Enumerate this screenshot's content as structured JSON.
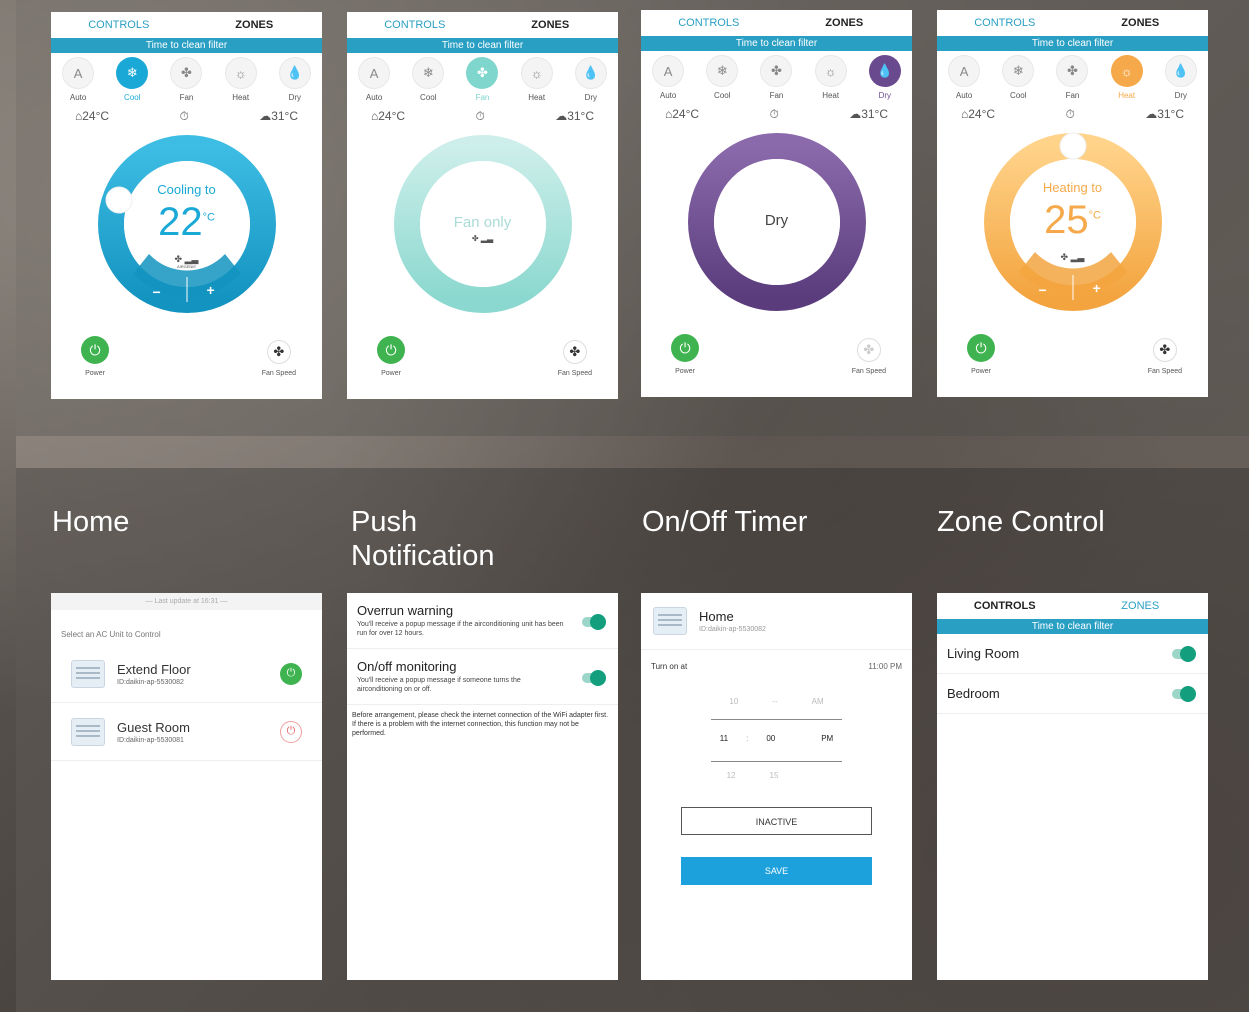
{
  "colors": {
    "accent": "#2a9fc4",
    "cool": "#1aa9d6",
    "fan": "#7fd6cd",
    "dry": "#6a4a8f",
    "heat": "#f5a94a",
    "power_green": "#3eb34f",
    "toggle": "#139f7d",
    "save": "#1da1dc"
  },
  "tabs": {
    "controls": "CONTROLS",
    "zones": "ZONES"
  },
  "filter_banner": "Time to clean filter",
  "modes": [
    "Auto",
    "Cool",
    "Fan",
    "Heat",
    "Dry"
  ],
  "mode_icons": [
    "auto-icon",
    "snowflake-icon",
    "fan-icon",
    "sun-icon",
    "droplet-icon"
  ],
  "indoor_temp": "24°C",
  "outdoor_temp": "31°C",
  "power_label": "Power",
  "fan_speed_label": "Fan Speed",
  "screens": {
    "cool": {
      "status": "Cooling to",
      "temp": "22",
      "unit": "°C",
      "brand": "AIRGENIE",
      "minus": "−",
      "plus": "+"
    },
    "fan": {
      "status": "Fan only"
    },
    "dry": {
      "status": "Dry"
    },
    "heat": {
      "status": "Heating to",
      "temp": "25",
      "unit": "°C",
      "minus": "−",
      "plus": "+"
    }
  },
  "sections": {
    "home": "Home",
    "push": "Push\nNotification",
    "timer": "On/Off Timer",
    "zone": "Zone Control"
  },
  "home_screen": {
    "last_update": "— Last update at 16:31 —",
    "prompt": "Select an AC Unit to Control",
    "units": [
      {
        "name": "Extend Floor",
        "id": "ID:daikin-ap-5530082",
        "on": true
      },
      {
        "name": "Guest Room",
        "id": "ID:daikin-ap-5530081",
        "on": false
      }
    ]
  },
  "push_screen": {
    "items": [
      {
        "title": "Overrun warning",
        "desc": "You'll receive a popup message if the airconditioning unit has been run for over 12 hours."
      },
      {
        "title": "On/off monitoring",
        "desc": "You'll receive a popup message if someone turns the airconditioning on or off."
      }
    ],
    "note": "Before arrangement, please check the internet connection of the WiFi adapter first. If there is a problem with the internet connection, this function may not be performed."
  },
  "timer_screen": {
    "home": "Home",
    "id": "ID:daikin-ap-5530082",
    "turn_on_at": "Turn on at",
    "time": "11:00 PM",
    "picker": {
      "above": [
        "10",
        "--",
        "AM"
      ],
      "selected": [
        "11",
        "00",
        "PM"
      ],
      "below": [
        "12",
        "15",
        ""
      ],
      "sep": ":"
    },
    "inactive": "INACTIVE",
    "save": "SAVE"
  },
  "zone_screen": {
    "zones": [
      "Living Room",
      "Bedroom"
    ]
  }
}
